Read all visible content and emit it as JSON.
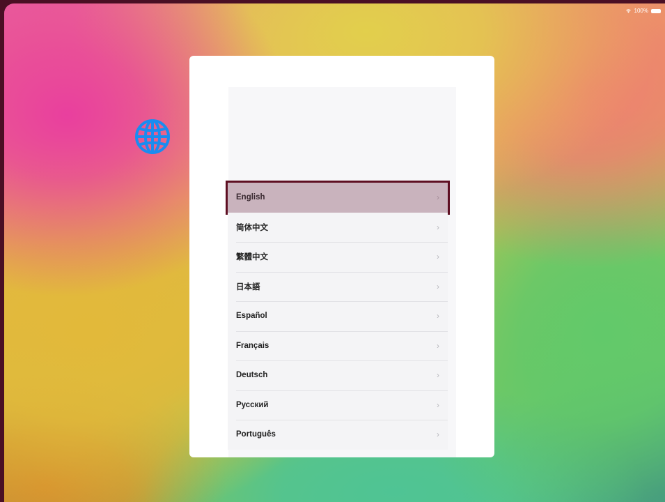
{
  "status_bar": {
    "battery_text": "100%",
    "wifi_icon": "wifi-icon",
    "battery_icon": "battery-icon"
  },
  "setup": {
    "header_icon": "globe-icon",
    "accent_color": "#1a8cf0",
    "selected_index": 0,
    "languages": [
      {
        "label": "English"
      },
      {
        "label": "简体中文"
      },
      {
        "label": "繁體中文"
      },
      {
        "label": "日本語"
      },
      {
        "label": "Español"
      },
      {
        "label": "Français"
      },
      {
        "label": "Deutsch"
      },
      {
        "label": "Русский"
      },
      {
        "label": "Português"
      }
    ]
  }
}
